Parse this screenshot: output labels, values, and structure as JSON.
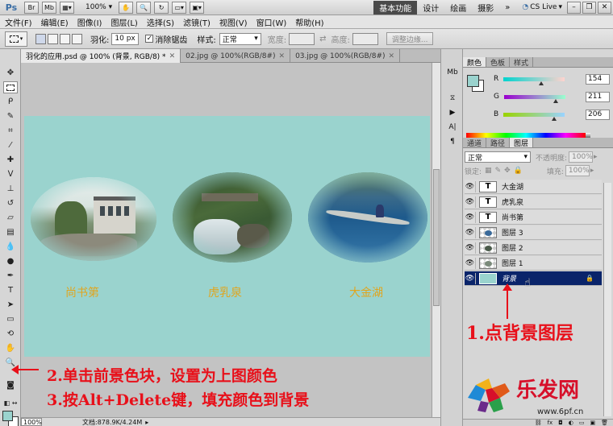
{
  "app": {
    "logo": "Ps",
    "bridge_btn": "Br",
    "minibridge_btn": "Mb",
    "zoom": "100%",
    "workspaces": [
      "基本功能",
      "设计",
      "绘画",
      "摄影"
    ],
    "more": "»",
    "cslive": "CS Live"
  },
  "menu": [
    "文件(F)",
    "编辑(E)",
    "图像(I)",
    "图层(L)",
    "选择(S)",
    "滤镜(T)",
    "视图(V)",
    "窗口(W)",
    "帮助(H)"
  ],
  "options": {
    "feather_label": "羽化:",
    "feather_value": "10 px",
    "antialias_label": "消除锯齿",
    "style_label": "样式:",
    "style_value": "正常",
    "width_label": "宽度:",
    "height_label": "高度:",
    "refine_button": "调整边缘..."
  },
  "doc_tabs": [
    {
      "label": "羽化的应用.psd @ 100% (背景, RGB/8) *"
    },
    {
      "label": "02.jpg @ 100%(RGB/8#)"
    },
    {
      "label": "03.jpg @ 100%(RGB/8#)"
    }
  ],
  "canvas": {
    "background_color": "#9ad3ce",
    "scenes": [
      {
        "label": "尚书第",
        "photo": "villa-garden"
      },
      {
        "label": "虎乳泉",
        "photo": "waterfall-stream"
      },
      {
        "label": "大金湖",
        "photo": "lake-boat"
      }
    ]
  },
  "status": {
    "zoom": "100%",
    "doc": "文档:878.9K/4.24M"
  },
  "color_panel": {
    "tabs": [
      "颜色",
      "色板",
      "样式"
    ],
    "r_label": "R",
    "r_value": "154",
    "g_label": "G",
    "g_value": "211",
    "b_label": "B",
    "b_value": "206",
    "fg_color": "#9ad3ce"
  },
  "layers_panel": {
    "tabs": [
      "通道",
      "路径",
      "图层"
    ],
    "blend_mode": "正常",
    "opacity_label": "不透明度:",
    "opacity_value": "100%",
    "lock_label": "锁定:",
    "fill_label": "填充:",
    "fill_value": "100%",
    "layers": [
      {
        "name": "大金湖",
        "kind": "text"
      },
      {
        "name": "虎乳泉",
        "kind": "text"
      },
      {
        "name": "尚书第",
        "kind": "text"
      },
      {
        "name": "图层 3",
        "kind": "raster"
      },
      {
        "name": "图层 2",
        "kind": "raster"
      },
      {
        "name": "图层 1",
        "kind": "raster"
      },
      {
        "name": "背景",
        "kind": "background",
        "selected": true
      }
    ]
  },
  "annotations": {
    "step1": "1.点背景图层",
    "step2": "2.单击前景色块，设置为上图颜色",
    "step3": "3.按Alt+Delete键，填充颜色到背景"
  },
  "watermark": {
    "name": "乐发网",
    "url": "www.6pf.cn"
  }
}
